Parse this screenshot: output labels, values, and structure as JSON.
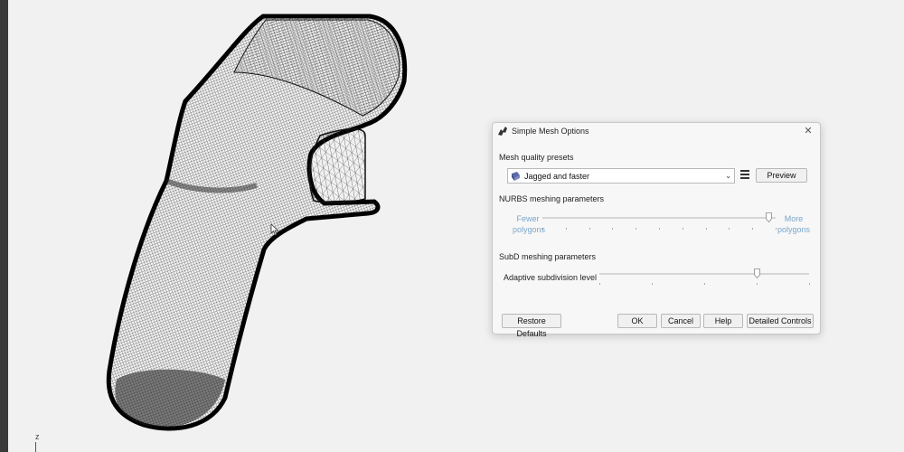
{
  "dialog": {
    "title": "Simple Mesh Options",
    "mesh_quality_label": "Mesh quality presets",
    "preset_selected": "Jagged and faster",
    "preview_label": "Preview",
    "nurbs_label": "NURBS meshing parameters",
    "nurbs_left_label": "Fewer\npolygons",
    "nurbs_right_label": "More\npolygons",
    "nurbs_level": 0.97,
    "subd_label": "SubD meshing parameters",
    "adaptive_label": "Adaptive subdivision level",
    "adaptive_level": 0.75,
    "buttons": {
      "restore": "Restore Defaults",
      "ok": "OK",
      "cancel": "Cancel",
      "help": "Help",
      "detailed": "Detailed Controls"
    }
  },
  "viewport": {
    "axis_label": "z"
  },
  "colors": {
    "accent_label": "#7aa6cc",
    "viewport_bg": "#f1f1f1",
    "mesh": "#111111"
  },
  "icons": [
    "rhino-icon",
    "close-icon",
    "preset-icon",
    "chevron-down-icon",
    "menu-icon",
    "cursor-icon"
  ]
}
